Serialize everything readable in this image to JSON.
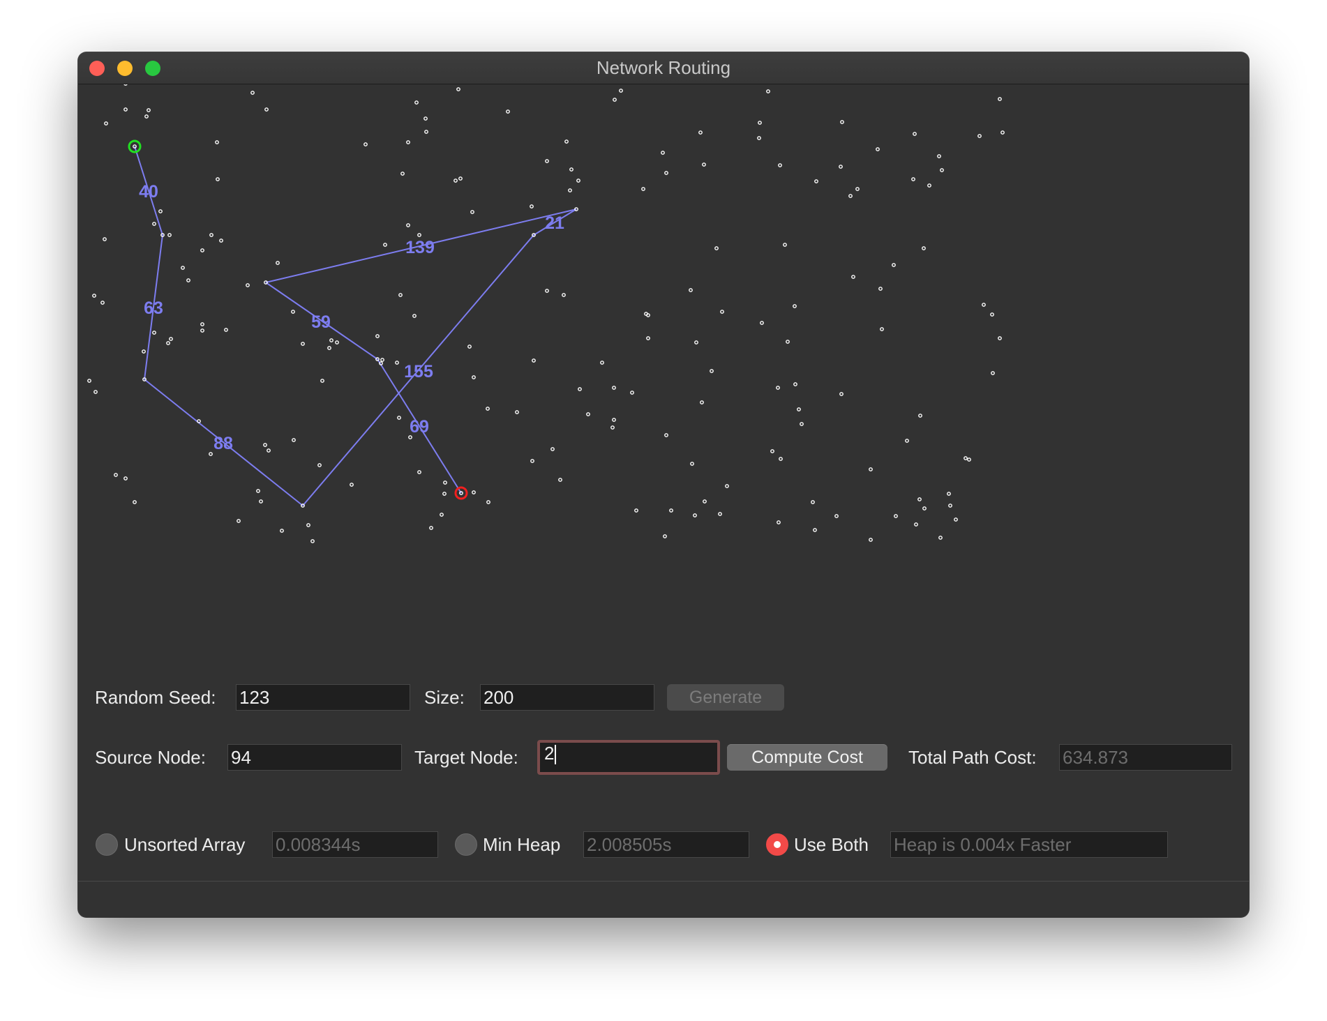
{
  "window": {
    "title": "Network Routing"
  },
  "graph": {
    "edge_color": "#7d7df0",
    "node_color": "#ffffff",
    "source_marker_color": "#22e022",
    "target_marker_color": "#f21f1f",
    "edge_weight_labels": [
      "40",
      "63",
      "88",
      "155",
      "21",
      "139",
      "59",
      "69"
    ]
  },
  "controls": {
    "random_seed_label": "Random Seed:",
    "random_seed_value": "123",
    "size_label": "Size:",
    "size_value": "200",
    "generate_label": "Generate",
    "source_label": "Source Node:",
    "source_value": "94",
    "target_label": "Target Node:",
    "target_value": "2",
    "compute_label": "Compute Cost",
    "total_cost_label": "Total Path Cost:",
    "total_cost_value": "634.873"
  },
  "options": {
    "unsorted_label": "Unsorted Array",
    "unsorted_time": "0.008344s",
    "heap_label": "Min Heap",
    "heap_time": "2.008505s",
    "both_label": "Use Both",
    "comparison_text": "Heap is 0.004x Faster",
    "selected": "Use Both"
  }
}
